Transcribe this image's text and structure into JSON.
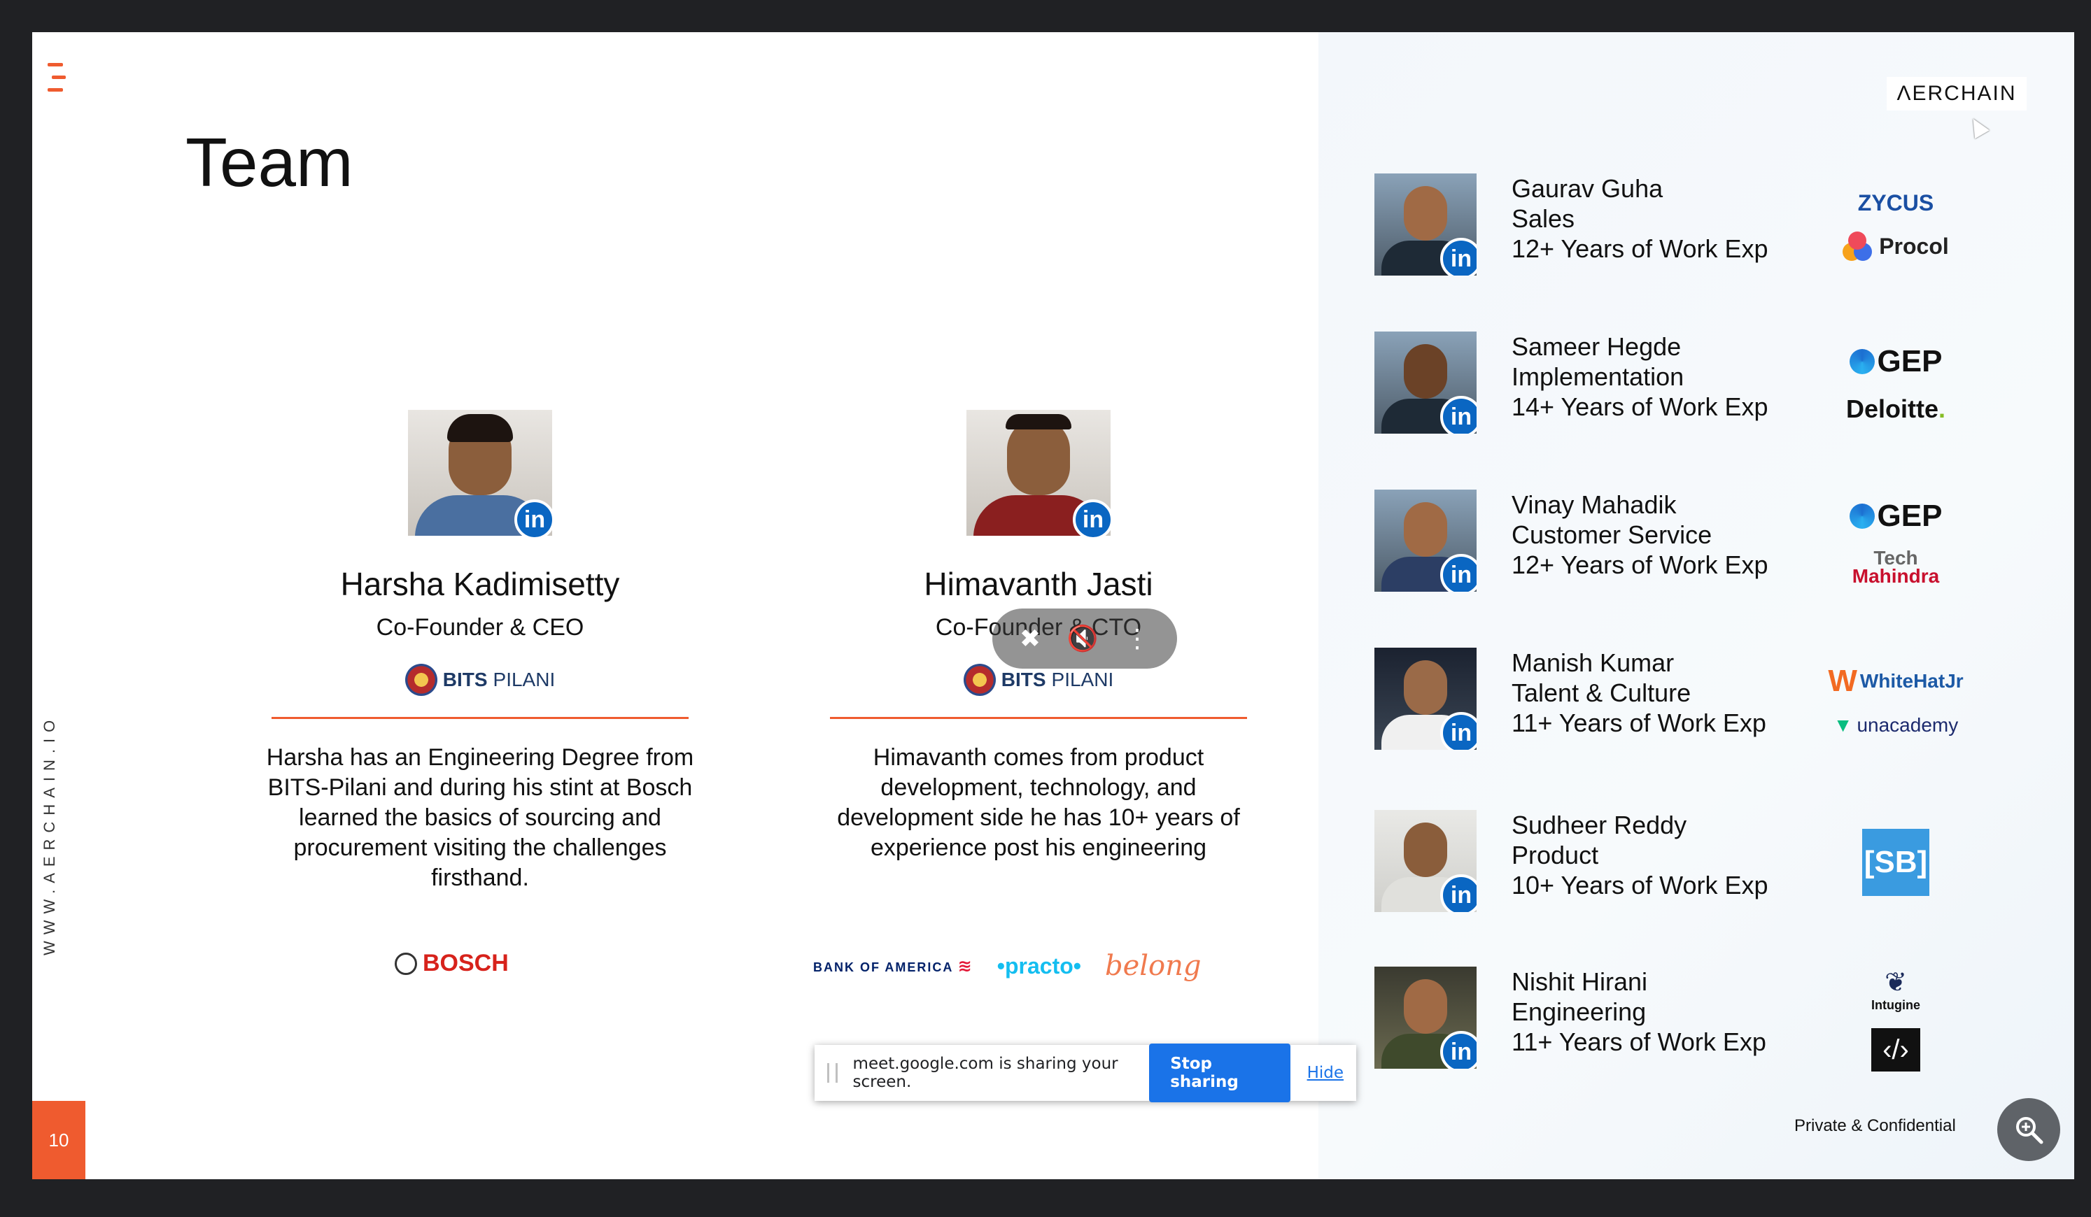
{
  "slide": {
    "title": "Team",
    "vertical_url": "WWW.AERCHAIN.IO",
    "page_number": "10",
    "brand_logo": "ΛERCHAIN",
    "confidential": "Private & Confidential"
  },
  "founders": [
    {
      "name": "Harsha Kadimisetty",
      "role": "Co-Founder & CEO",
      "education_bold": "BITS",
      "education_light": "PILANI",
      "bio": "Harsha has an Engineering Degree from BITS-Pilani and during his stint at Bosch learned the basics of sourcing and procurement visiting the challenges firsthand.",
      "companies": [
        "BOSCH"
      ]
    },
    {
      "name": "Himavanth Jasti",
      "role": "Co-Founder & CTO",
      "education_bold": "BITS",
      "education_light": "PILANI",
      "bio": "Himavanth comes from product development, technology, and development side he has 10+  years of experience post his engineering",
      "companies": [
        "BANK OF AMERICA",
        "•practo•",
        "belong"
      ]
    }
  ],
  "linkedin_glyph": "in",
  "team": [
    {
      "name": "Gaurav Guha",
      "role": "Sales",
      "experience": "12+ Years of Work Exp",
      "logos": [
        "ZYCUS",
        "Procol"
      ]
    },
    {
      "name": "Sameer Hegde",
      "role": "Implementation",
      "experience": "14+ Years of Work Exp",
      "logos": [
        "GEP",
        "Deloitte"
      ]
    },
    {
      "name": "Vinay Mahadik",
      "role": "Customer Service",
      "experience": "12+ Years of Work Exp",
      "logos": [
        "GEP",
        "Mahindra"
      ]
    },
    {
      "name": "Manish Kumar",
      "role": "Talent & Culture",
      "experience": "11+ Years of Work Exp",
      "logos": [
        "WhiteHatJr",
        "unacademy"
      ]
    },
    {
      "name": "Sudheer Reddy",
      "role": "Product",
      "experience": "10+ Years of Work Exp",
      "logos": [
        "[SB]"
      ]
    },
    {
      "name": "Nishit Hirani",
      "role": "Engineering",
      "experience": "11+ Years of Work Exp",
      "logos": [
        "Intugine",
        "‹/›"
      ]
    }
  ],
  "share_bar": {
    "message": "meet.google.com is sharing your screen.",
    "stop_label": "Stop sharing",
    "hide_label": "Hide"
  },
  "icons": {
    "mic_off": "mic-off-icon",
    "speaker_off": "speaker-off-icon",
    "more": "more-vert-icon",
    "zoom": "zoom-in-icon"
  },
  "colors": {
    "accent": "#ef5b2f",
    "linkedin": "#0a66c2",
    "share_button": "#1a73e8"
  }
}
